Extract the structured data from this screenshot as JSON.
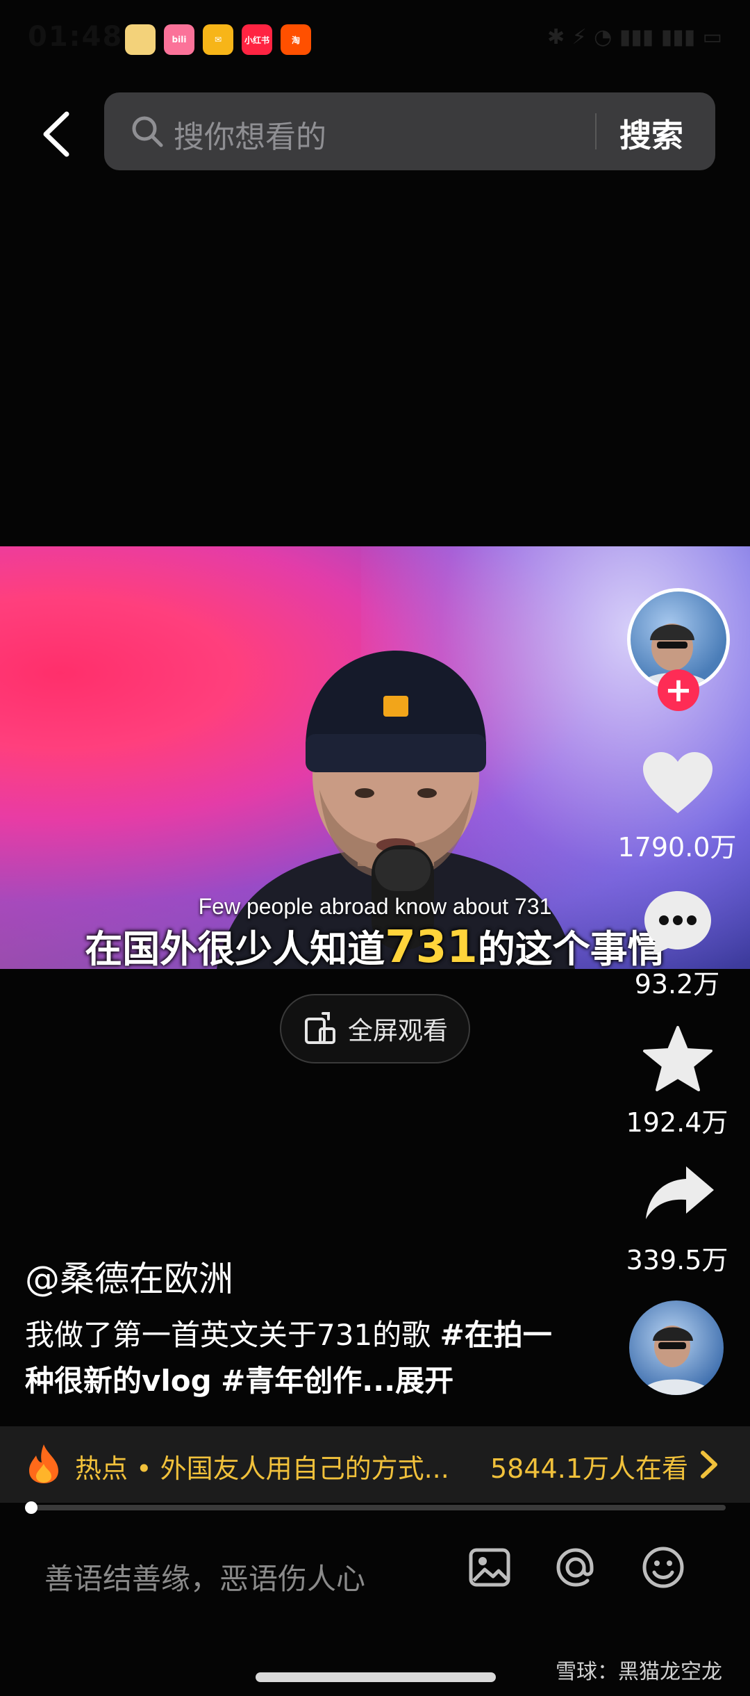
{
  "status_bar": {
    "time": "01:48",
    "apps": [
      {
        "name": "doudizhu-app-icon",
        "label": "",
        "color": "#f3d27a"
      },
      {
        "name": "bilibili-app-icon",
        "label": "bili",
        "color": "#fb7299"
      },
      {
        "name": "mail-app-icon",
        "label": "✉",
        "color": "#f7b518"
      },
      {
        "name": "xiaohongshu-app-icon",
        "label": "小红书",
        "color": "#ff2442"
      },
      {
        "name": "taobao-app-icon",
        "label": "淘",
        "color": "#ff5000"
      }
    ],
    "indicators": "✱ ⚡ ◔ ▮▮▮ ▮▮▮ ▭"
  },
  "search": {
    "placeholder": "搜你想看的",
    "button_label": "搜索"
  },
  "video": {
    "subtitle_en": "Few people abroad know about 731",
    "subtitle_cn_before": "在国外很少人知道",
    "subtitle_cn_highlight": "731",
    "subtitle_cn_after": "的这个事情"
  },
  "fullscreen": {
    "label": "全屏观看"
  },
  "actions": {
    "likes": "1790.0万",
    "comments": "93.2万",
    "favorites": "192.4万",
    "shares": "339.5万",
    "follow_symbol": "+"
  },
  "post": {
    "author": "@桑德在欧洲",
    "caption_text": "我做了第一首英文关于731的歌",
    "tag_1": "#在拍一种很新的vlog",
    "tag_2": "#青年创作",
    "expand_label": "...展开"
  },
  "hot": {
    "text": "热点 • 外国友人用自己的方式...",
    "viewers": "5844.1万人在看"
  },
  "progress": {
    "played_fraction": 0.005
  },
  "comment": {
    "placeholder": "善语结善缘，恶语伤人心"
  },
  "watermark": "雪球：黑猫龙空龙",
  "colors": {
    "accent": "#fe2c55",
    "hot_text": "#f1c13b",
    "subtitle_highlight": "#ffd43b"
  }
}
